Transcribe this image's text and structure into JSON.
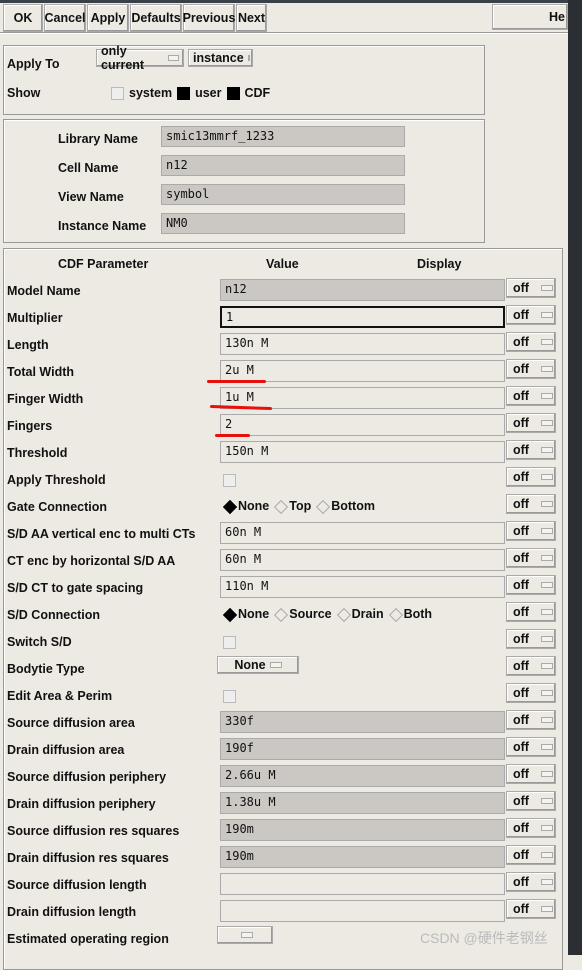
{
  "toolbar": {
    "ok": "OK",
    "cancel": "Cancel",
    "apply": "Apply",
    "defaults": "Defaults",
    "previous": "Previous",
    "next": "Next",
    "help": "He"
  },
  "apply_to": {
    "label": "Apply To",
    "scope": "only current",
    "target": "instance"
  },
  "show": {
    "label": "Show",
    "system": "system",
    "user": "user",
    "cdf": "CDF",
    "system_checked": false,
    "user_checked": true,
    "cdf_checked": true
  },
  "cell": {
    "library_label": "Library Name",
    "library": "smic13mmrf_1233",
    "cell_label": "Cell Name",
    "cell": "n12",
    "view_label": "View Name",
    "view": "symbol",
    "instance_label": "Instance Name",
    "instance": "NM0"
  },
  "header": {
    "param": "CDF Parameter",
    "value": "Value",
    "display": "Display"
  },
  "params": [
    {
      "label": "Model Name",
      "type": "text",
      "value": "n12",
      "gray": true,
      "display": "off"
    },
    {
      "label": "Multiplier",
      "type": "text",
      "value": "1",
      "focus": true,
      "display": "off"
    },
    {
      "label": "Length",
      "type": "text",
      "value": "130n M",
      "display": "off"
    },
    {
      "label": "Total Width",
      "type": "text",
      "value": "2u M",
      "display": "off"
    },
    {
      "label": "Finger Width",
      "type": "text",
      "value": "1u M",
      "display": "off"
    },
    {
      "label": "Fingers",
      "type": "text",
      "value": "2",
      "display": "off"
    },
    {
      "label": "Threshold",
      "type": "text",
      "value": "150n M",
      "display": "off"
    },
    {
      "label": "Apply Threshold",
      "type": "check",
      "checked": false,
      "display": "off"
    },
    {
      "label": "Gate Connection",
      "type": "radio",
      "options": [
        "None",
        "Top",
        "Bottom"
      ],
      "selected": "None",
      "display": "off"
    },
    {
      "label": "S/D AA vertical enc to multi CTs",
      "type": "text",
      "value": "60n M",
      "display": "off"
    },
    {
      "label": "CT enc by horizontal S/D AA",
      "type": "text",
      "value": "60n M",
      "display": "off"
    },
    {
      "label": "S/D CT to gate spacing",
      "type": "text",
      "value": "110n M",
      "display": "off"
    },
    {
      "label": "S/D Connection",
      "type": "radio",
      "options": [
        "None",
        "Source",
        "Drain",
        "Both"
      ],
      "selected": "None",
      "display": "off"
    },
    {
      "label": "Switch S/D",
      "type": "check",
      "checked": false,
      "display": "off"
    },
    {
      "label": "Bodytie Type",
      "type": "select",
      "value": "None",
      "display": "off"
    },
    {
      "label": "Edit Area & Perim",
      "type": "check",
      "checked": false,
      "display": "off"
    },
    {
      "label": "Source diffusion area",
      "type": "text",
      "value": "330f",
      "gray": true,
      "display": "off"
    },
    {
      "label": "Drain diffusion area",
      "type": "text",
      "value": "190f",
      "gray": true,
      "display": "off"
    },
    {
      "label": "Source diffusion periphery",
      "type": "text",
      "value": "2.66u M",
      "gray": true,
      "display": "off"
    },
    {
      "label": "Drain diffusion periphery",
      "type": "text",
      "value": "1.38u M",
      "gray": true,
      "display": "off"
    },
    {
      "label": "Source diffusion res squares",
      "type": "text",
      "value": "190m",
      "gray": true,
      "display": "off"
    },
    {
      "label": "Drain diffusion res squares",
      "type": "text",
      "value": "190m",
      "gray": true,
      "display": "off"
    },
    {
      "label": "Source diffusion length",
      "type": "text",
      "value": "",
      "display": "off"
    },
    {
      "label": "Drain diffusion length",
      "type": "text",
      "value": "",
      "display": "off"
    },
    {
      "label": "Estimated operating region",
      "type": "select",
      "value": "",
      "display": ""
    }
  ],
  "watermark": "CSDN @硬件老钢丝",
  "colors": {
    "annotation": "#e8100c",
    "panel": "#edeae4",
    "readonly": "#cbc8c3"
  }
}
